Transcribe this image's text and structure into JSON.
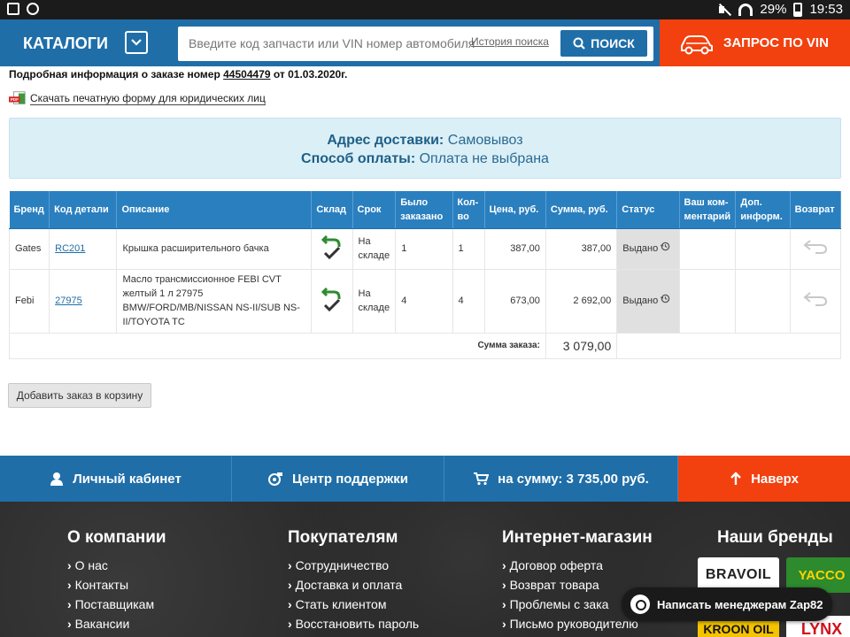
{
  "status_bar": {
    "battery": "29%",
    "time": "19:53"
  },
  "header": {
    "catalogs_label": "КАТАЛОГИ",
    "search_placeholder": "Введите код запчасти или VIN номер автомобиля",
    "history_label": "История поиска",
    "search_button": "ПОИСК",
    "vin_request_label": "ЗАПРОС ПО VIN"
  },
  "order": {
    "info_prefix": "Подробная информация о заказе номер",
    "number": "44504479",
    "date_text": "от 01.03.2020г.",
    "print_link": "Скачать печатную форму для юридических лиц",
    "pdf_icon_text": "PDF",
    "delivery_label": "Адрес доставки:",
    "delivery_value": "Самовывоз",
    "payment_label": "Способ оплаты:",
    "payment_value": "Оплата не выбрана"
  },
  "table": {
    "headers": [
      "Бренд",
      "Код детали",
      "Описание",
      "Склад",
      "Срок",
      "Было заказано",
      "Кол-во",
      "Цена, руб.",
      "Сумма, руб.",
      "Статус",
      "Ваш ком-ментарий",
      "Доп. информ.",
      "Возврат"
    ],
    "rows": [
      {
        "brand": "Gates",
        "code": "RC201",
        "description": "Крышка расширительного бачка",
        "term": "На складе",
        "ordered": "1",
        "qty": "1",
        "price": "387,00",
        "sum": "387,00",
        "status": "Выдано",
        "comment": "",
        "info": ""
      },
      {
        "brand": "Febi",
        "code": "27975",
        "description": "Масло трансмиссионное FEBI CVT желтый 1 л 27975 BMW/FORD/MB/NISSAN NS-II/SUB NS-II/TOYOTA TC",
        "term": "На складе",
        "ordered": "4",
        "qty": "4",
        "price": "673,00",
        "sum": "2 692,00",
        "status": "Выдано",
        "comment": "",
        "info": ""
      }
    ],
    "total_label": "Сумма заказа:",
    "total_value": "3 079,00"
  },
  "add_to_cart_label": "Добавить заказ в корзину",
  "bottom_nav": {
    "cabinet": "Личный кабинет",
    "support": "Центр поддержки",
    "cart": "на сумму: 3 735,00 руб.",
    "up": "Наверх"
  },
  "footer": {
    "about": {
      "title": "О компании",
      "items": [
        "О нас",
        "Контакты",
        "Поставщикам",
        "Вакансии"
      ]
    },
    "buyers": {
      "title": "Покупателям",
      "items": [
        "Сотрудничество",
        "Доставка и оплата",
        "Стать клиентом",
        "Восстановить пароль"
      ]
    },
    "shop": {
      "title": "Интернет-магазин",
      "items": [
        "Договор оферта",
        "Возврат товара",
        "Проблемы с зака",
        "Письмо руководителю"
      ]
    },
    "brands": {
      "title": "Наши бренды",
      "logos": [
        "BRAVOIL",
        "YACCO",
        "KROON OIL",
        "LYNX"
      ]
    }
  },
  "chat_label": "Написать менеджерам Zap82",
  "colors": {
    "primary": "#1f6ea8",
    "accent": "#f2400f",
    "green_icon": "#2e8b2e"
  }
}
